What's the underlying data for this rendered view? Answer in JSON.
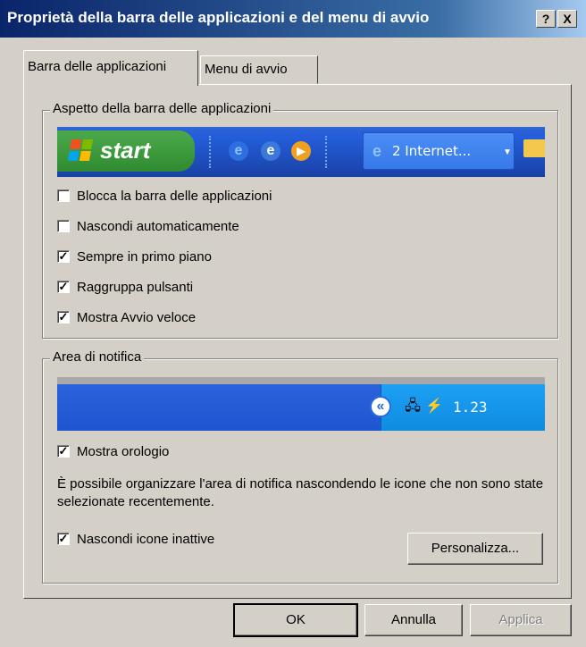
{
  "window": {
    "title": "Proprietà della barra delle applicazioni e del menu di avvio",
    "help_label": "?",
    "close_label": "X"
  },
  "tabs": [
    {
      "label": "Barra delle applicazioni",
      "active": true
    },
    {
      "label": "Menu di avvio",
      "active": false
    }
  ],
  "appearance": {
    "legend": "Aspetto della barra delle applicazioni",
    "taskbar_preview": {
      "start_label": "start",
      "task_label": "2 Internet...",
      "task_icon": "ie-icon"
    },
    "options": [
      {
        "label": "Blocca la barra delle applicazioni",
        "checked": false
      },
      {
        "label": "Nascondi automaticamente",
        "checked": false
      },
      {
        "label": "Sempre in primo piano",
        "checked": true
      },
      {
        "label": "Raggruppa pulsanti",
        "checked": true
      },
      {
        "label": "Mostra Avvio veloce",
        "checked": true
      }
    ]
  },
  "notification": {
    "legend": "Area di notifica",
    "clock_text": "1.23",
    "show_clock": {
      "label": "Mostra orologio",
      "checked": true
    },
    "description": "È possibile organizzare l'area di notifica nascondendo le icone che non sono state selezionate recentemente.",
    "hide_inactive": {
      "label": "Nascondi icone inattive",
      "checked": true
    },
    "customize_label": "Personalizza..."
  },
  "buttons": {
    "ok": "OK",
    "cancel": "Annulla",
    "apply": "Applica"
  },
  "colors": {
    "title_bar": "#0a246a",
    "dialog_face": "#d4d0c8",
    "taskbar_blue": "#245edb",
    "start_green": "#3d9b3d"
  }
}
